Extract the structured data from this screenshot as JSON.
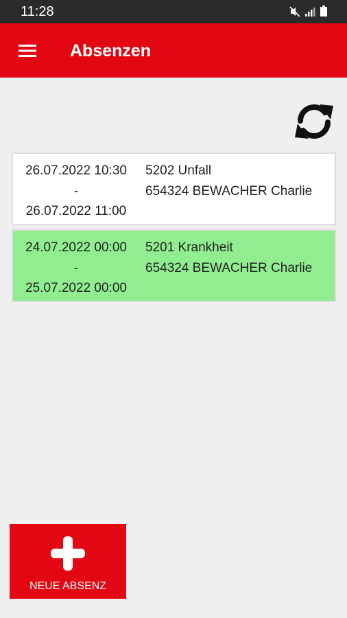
{
  "status": {
    "time": "11:28"
  },
  "appbar": {
    "title": "Absenzen"
  },
  "icons": {
    "menu": "hamburger-icon",
    "refresh": "refresh-icon",
    "add": "plus-icon",
    "mute": "mute-icon",
    "signal": "signal-icon",
    "battery": "battery-icon"
  },
  "absences": [
    {
      "start": "26.07.2022 10:30",
      "separator": "-",
      "end": "26.07.2022 11:00",
      "type": "5202 Unfall",
      "person": "654324 BEWACHER Charlie",
      "bg": "#ffffff"
    },
    {
      "start": "24.07.2022 00:00",
      "separator": "-",
      "end": "25.07.2022 00:00",
      "type": "5201 Krankheit",
      "person": "654324 BEWACHER Charlie",
      "bg": "#90ee90"
    }
  ],
  "new_button": {
    "label": "NEUE ABSENZ"
  },
  "colors": {
    "primary": "#e30613",
    "highlight": "#90ee90"
  }
}
